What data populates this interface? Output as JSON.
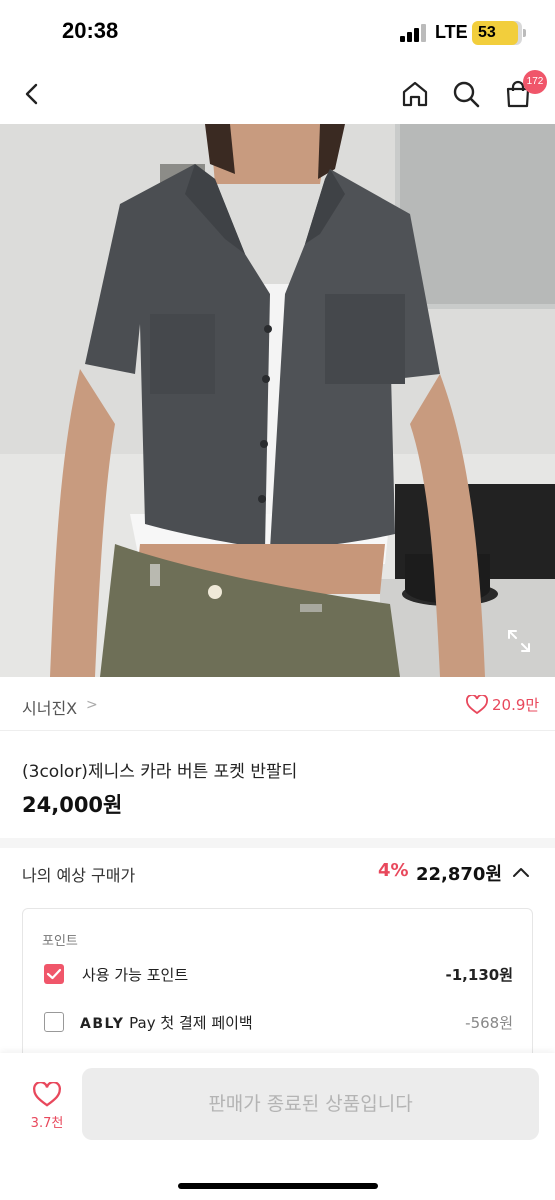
{
  "status_bar": {
    "time": "20:38",
    "network": "LTE",
    "battery": "53"
  },
  "header": {
    "back_icon": "chevron-left-icon",
    "home_icon": "home-icon",
    "search_icon": "search-icon",
    "cart_icon": "shopping-bag-icon",
    "cart_count": "172"
  },
  "product": {
    "image_icon": "expand-icon",
    "seller": "시너진X",
    "seller_chevron": ">",
    "likes": "20.9만",
    "title": "(3color)제니스 카라 버튼 포켓 반팔티",
    "price": "24,000원"
  },
  "expected_price": {
    "label": "나의 예상 구매가",
    "discount": "4%",
    "price": "22,870원"
  },
  "points": {
    "heading": "포인트",
    "rows": [
      {
        "brand": "",
        "label": "사용 가능 포인트",
        "value": "-1,130원",
        "checked": true
      },
      {
        "brand": "ABLY",
        "label": "Pay 첫 결제 페이백",
        "value": "-568원",
        "checked": false
      }
    ]
  },
  "bottom_bar": {
    "wish_count": "3.7천",
    "buy_label": "판매가 종료된 상품입니다"
  },
  "colors": {
    "accent": "#f0566a",
    "price_red": "#e8485c",
    "battery": "#f2ce3c"
  }
}
